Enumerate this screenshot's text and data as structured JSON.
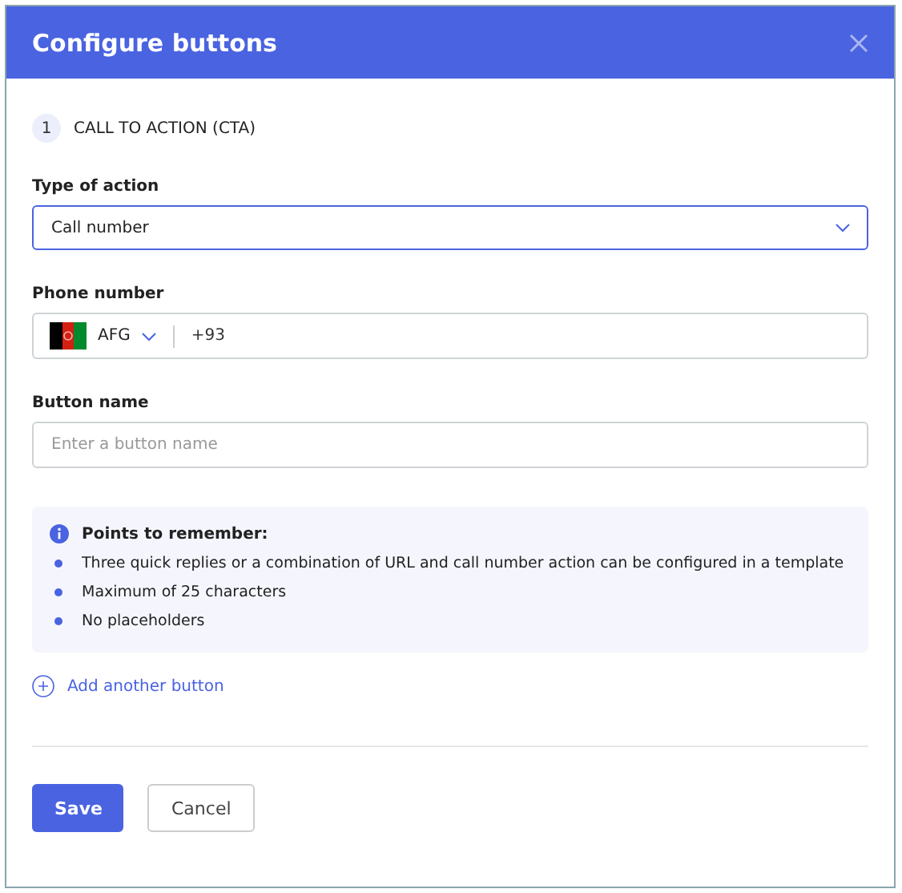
{
  "dialog": {
    "title": "Configure buttons"
  },
  "step": {
    "number": "1",
    "label": "CALL TO ACTION (CTA)"
  },
  "action_type": {
    "label": "Type of action",
    "value": "Call number",
    "focused": true
  },
  "phone": {
    "label": "Phone number",
    "country": "AFG",
    "code": "+93"
  },
  "button_name": {
    "label": "Button name",
    "placeholder": "Enter a button name"
  },
  "notes": {
    "title": "Points to remember:",
    "items": [
      "Three quick replies or a combination of URL and call number action can be configured in a template",
      "Maximum of 25 characters",
      "No placeholders"
    ]
  },
  "add_link": "Add another button",
  "buttons": [
    {
      "label": "Save",
      "kind": "primary"
    },
    {
      "label": "Cancel",
      "kind": "secondary"
    }
  ]
}
